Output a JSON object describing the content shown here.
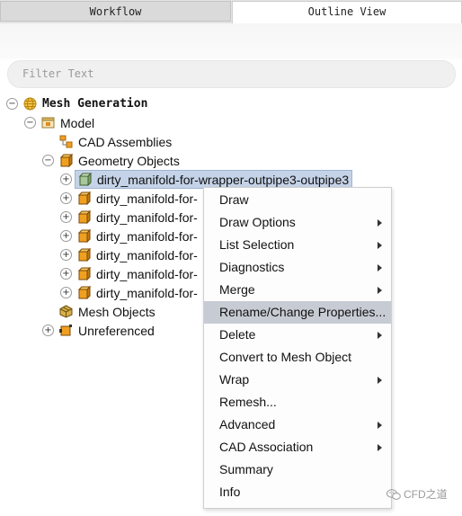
{
  "tabs": [
    {
      "label": "Workflow",
      "active": false
    },
    {
      "label": "Outline View",
      "active": true
    }
  ],
  "filter": {
    "placeholder": "Filter Text",
    "value": ""
  },
  "tree": {
    "root": {
      "label": "Mesh Generation",
      "expanded": true
    },
    "model": {
      "label": "Model",
      "expanded": true
    },
    "cad_assemblies": {
      "label": "CAD Assemblies"
    },
    "geometry_objects": {
      "label": "Geometry Objects",
      "expanded": true
    },
    "geometry_items": [
      {
        "label": "dirty_manifold-for-wrapper-outpipe3-outpipe3",
        "selected": true
      },
      {
        "label": "dirty_manifold-for-"
      },
      {
        "label": "dirty_manifold-for-"
      },
      {
        "label": "dirty_manifold-for-"
      },
      {
        "label": "dirty_manifold-for-"
      },
      {
        "label": "dirty_manifold-for-"
      },
      {
        "label": "dirty_manifold-for-"
      }
    ],
    "mesh_objects": {
      "label": "Mesh Objects"
    },
    "unreferenced": {
      "label": "Unreferenced",
      "expanded": false
    }
  },
  "context_menu": {
    "items": [
      {
        "label": "Draw",
        "submenu": false
      },
      {
        "label": "Draw Options",
        "submenu": true
      },
      {
        "label": "List Selection",
        "submenu": true
      },
      {
        "label": "Diagnostics",
        "submenu": true
      },
      {
        "label": "Merge",
        "submenu": true
      },
      {
        "label": "Rename/Change Properties...",
        "submenu": false,
        "highlighted": true
      },
      {
        "label": "Delete",
        "submenu": true
      },
      {
        "label": "Convert to Mesh Object",
        "submenu": false
      },
      {
        "label": "Wrap",
        "submenu": true
      },
      {
        "label": "Remesh...",
        "submenu": false
      },
      {
        "label": "Advanced",
        "submenu": true
      },
      {
        "label": "CAD Association",
        "submenu": true
      },
      {
        "label": "Summary",
        "submenu": false
      },
      {
        "label": "Info",
        "submenu": false
      }
    ]
  },
  "watermark": {
    "text": "CFD之道",
    "icon": "wechat-icon"
  },
  "colors": {
    "selection": "#c5d3e8",
    "menu_highlight": "#c7cbd3",
    "geometry_icon": "#f0a020",
    "tab_inactive": "#dadada"
  },
  "toggle_symbols": {
    "expanded": "−",
    "collapsed": "+"
  }
}
